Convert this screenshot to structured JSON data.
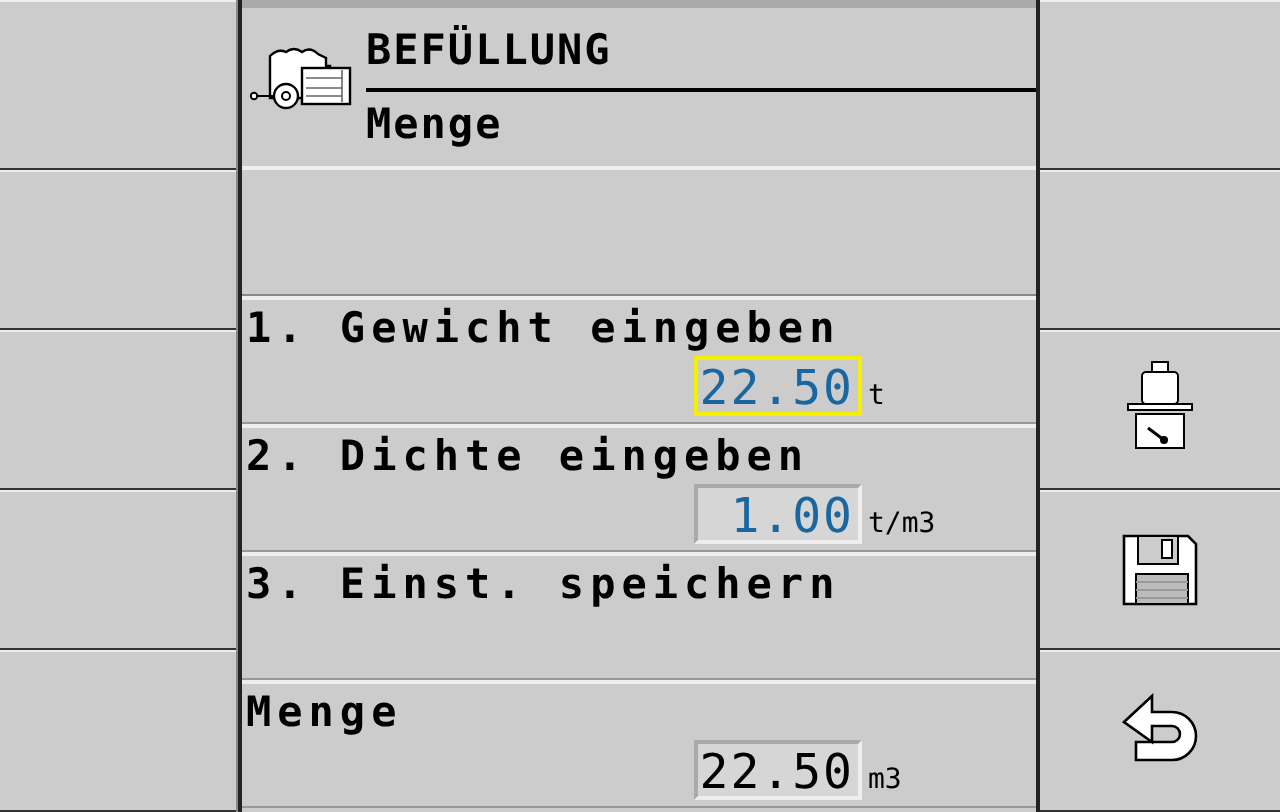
{
  "header": {
    "title": "BEFÜLLUNG",
    "subtitle": "Menge"
  },
  "rows": [
    {
      "kind": "entry",
      "label": "1. Gewicht eingeben",
      "value": "22.50",
      "unit": "t",
      "editable": true,
      "selected": true
    },
    {
      "kind": "entry",
      "label": "2. Dichte eingeben",
      "value": "1.00",
      "unit": "t/m3",
      "editable": true,
      "selected": false
    },
    {
      "kind": "action",
      "label": "3. Einst. speichern"
    },
    {
      "kind": "entry",
      "label": "Menge",
      "value": "22.50",
      "unit": "m3",
      "editable": false,
      "selected": false
    }
  ]
}
